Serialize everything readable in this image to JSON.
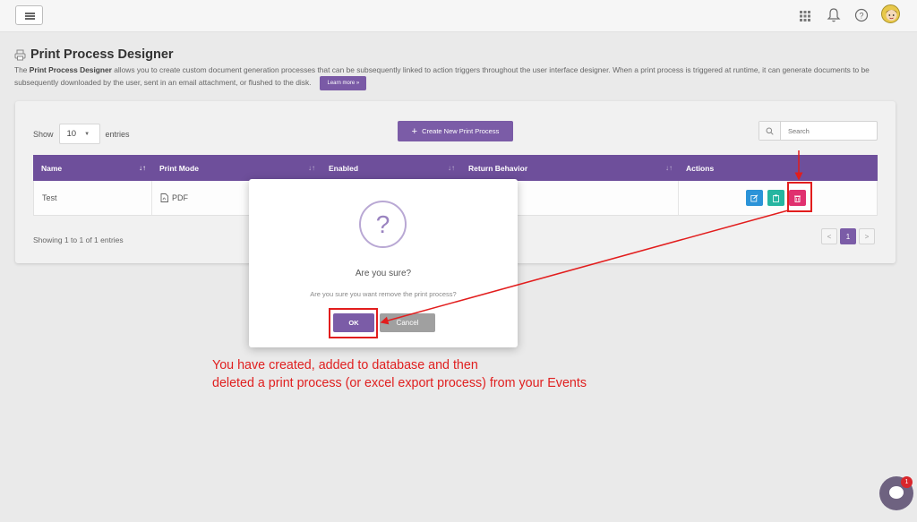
{
  "topbar": {
    "menu_icon": "hamburger-icon",
    "apps_icon": "grid-icon",
    "bell_icon": "bell-icon",
    "help_icon": "question-circle-icon",
    "avatar_icon": "user-avatar"
  },
  "page": {
    "title": "Print Process Designer",
    "description_bold": "Print Process Designer",
    "description_pre": "The ",
    "description_post": " allows you to create custom document generation processes that can be subsequently linked to action triggers throughout the user interface designer. When a print process is triggered at runtime, it can generate documents to be subsequently downloaded by the user, sent in an email attachment, or flushed to the disk.",
    "learn_more": "Learn more »"
  },
  "toolbar": {
    "show_label": "Show",
    "entries_value": "10",
    "entries_label": "entries",
    "create_label": "Create New Print Process",
    "search_placeholder": "Search"
  },
  "table": {
    "columns": [
      "Name",
      "Print Mode",
      "Enabled",
      "Return Behavior",
      "Actions"
    ],
    "rows": [
      {
        "name": "Test",
        "print_mode": "PDF",
        "enabled": "",
        "return_behavior": ""
      }
    ],
    "info": "Showing 1 to 1 of 1 entries",
    "pagination": {
      "prev": "<",
      "current": "1",
      "next": ">"
    }
  },
  "dialog": {
    "icon": "?",
    "title": "Are you sure?",
    "text": "Are you sure you want remove the print process?",
    "ok_label": "OK",
    "cancel_label": "Cancel"
  },
  "annotation": {
    "line1": "You have created, added to database and then",
    "line2": "deleted a print process (or excel export process) from your Events",
    "color": "#e21d1d"
  },
  "chat": {
    "badge": "1"
  },
  "colors": {
    "accent": "#7b5ca7",
    "header": "#6e4f9b",
    "edit": "#2b93d8",
    "copy": "#26b5a0",
    "delete": "#e0306f"
  }
}
